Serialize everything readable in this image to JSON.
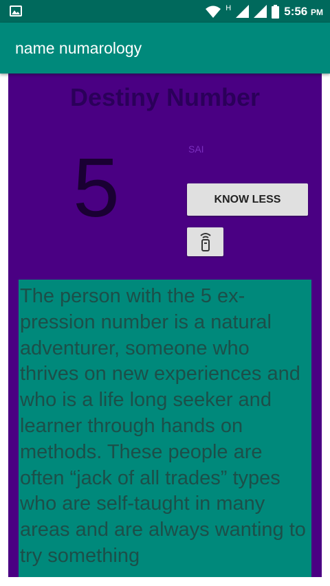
{
  "status_bar": {
    "time": "5:56",
    "ampm": "PM",
    "network_type": "H",
    "icons": [
      "image-notification-icon",
      "wifi-icon",
      "signal-icon",
      "signal-icon",
      "battery-icon"
    ]
  },
  "app_bar": {
    "title": "name numarology"
  },
  "panel": {
    "title": "Destiny Number",
    "number": "5",
    "name": "SAI",
    "know_less_label": "KNOW LESS",
    "icon_button": "phone-icon"
  },
  "description": {
    "text": "The person with the 5 ex-pression number is a natural adventurer, someone who thrives on new experiences and who is a life long seeker and learner through hands on methods. These people are often “jack of all trades” types who are self-taught in many areas and are always wanting to try something"
  },
  "colors": {
    "status_bar": "#00695c",
    "app_bar": "#00897b",
    "panel": "#4a0083",
    "description_bg": "#00897b"
  }
}
